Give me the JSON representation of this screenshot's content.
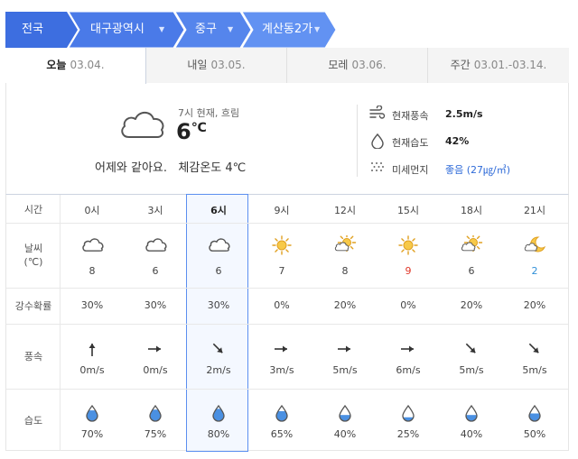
{
  "breadcrumb": {
    "items": [
      {
        "label": "전국",
        "has_dropdown": false
      },
      {
        "label": "대구광역시",
        "has_dropdown": true
      },
      {
        "label": "중구",
        "has_dropdown": true
      },
      {
        "label": "계산동2가",
        "has_dropdown": true
      }
    ],
    "dropdown_glyph": "▼"
  },
  "tabs": [
    {
      "label": "오늘",
      "date": "03.04.",
      "active": true
    },
    {
      "label": "내일",
      "date": "03.05.",
      "active": false
    },
    {
      "label": "모레",
      "date": "03.06.",
      "active": false
    },
    {
      "label": "주간",
      "date": "03.01.-03.14.",
      "active": false
    }
  ],
  "current": {
    "label": "7시 현재, 흐림",
    "temp": "6",
    "temp_unit": "℃",
    "icon": "cloud-icon",
    "comment": "어제와 같아요.   체감온도 4℃"
  },
  "details": [
    {
      "icon": "wind-icon",
      "label": "현재풍속",
      "value": "2.5m/s"
    },
    {
      "icon": "humidity-drop-icon",
      "label": "현재습도",
      "value": "42%"
    },
    {
      "icon": "dust-icon",
      "label": "미세먼지",
      "value": "좋음 (27㎍/㎥)"
    }
  ],
  "hourly": {
    "row_labels": {
      "time": "시간",
      "weather": "날씨\n(℃)",
      "precip": "강수확률",
      "wind": "풍속",
      "humidity": "습도"
    },
    "columns": [
      {
        "hour": "0시",
        "icon": "cloud-icon",
        "temp": "8",
        "temp_color": "",
        "precip": "30%",
        "wind_dir": "north",
        "wind": "0m/s",
        "humidity": "70%",
        "hum_level": 0.7
      },
      {
        "hour": "3시",
        "icon": "cloud-icon",
        "temp": "6",
        "temp_color": "",
        "precip": "30%",
        "wind_dir": "east",
        "wind": "0m/s",
        "humidity": "75%",
        "hum_level": 0.75
      },
      {
        "hour": "6시",
        "icon": "cloud-icon",
        "temp": "6",
        "temp_color": "",
        "precip": "30%",
        "wind_dir": "southeast",
        "wind": "2m/s",
        "humidity": "80%",
        "hum_level": 0.8,
        "current": true
      },
      {
        "hour": "9시",
        "icon": "sun-icon",
        "temp": "7",
        "temp_color": "",
        "precip": "0%",
        "wind_dir": "east",
        "wind": "3m/s",
        "humidity": "65%",
        "hum_level": 0.65
      },
      {
        "hour": "12시",
        "icon": "sun-cloud-icon",
        "temp": "8",
        "temp_color": "",
        "precip": "20%",
        "wind_dir": "east",
        "wind": "5m/s",
        "humidity": "40%",
        "hum_level": 0.4
      },
      {
        "hour": "15시",
        "icon": "sun-icon",
        "temp": "9",
        "temp_color": "#e0392b",
        "precip": "0%",
        "wind_dir": "east",
        "wind": "6m/s",
        "humidity": "25%",
        "hum_level": 0.25
      },
      {
        "hour": "18시",
        "icon": "sun-cloud-icon",
        "temp": "6",
        "temp_color": "",
        "precip": "20%",
        "wind_dir": "southeast",
        "wind": "5m/s",
        "humidity": "40%",
        "hum_level": 0.4
      },
      {
        "hour": "21시",
        "icon": "moon-cloud-icon",
        "temp": "2",
        "temp_color": "#2f8fd8",
        "precip": "20%",
        "wind_dir": "southeast",
        "wind": "5m/s",
        "humidity": "50%",
        "hum_level": 0.5
      }
    ]
  },
  "colors": {
    "breadcrumb_1": "#3d6ee0",
    "breadcrumb_2": "#4a7ae8",
    "breadcrumb_3": "#5585ec",
    "breadcrumb_4": "#6292f2",
    "highlight_border": "#5b8ff0",
    "drop_fill": "#4a90e2"
  }
}
